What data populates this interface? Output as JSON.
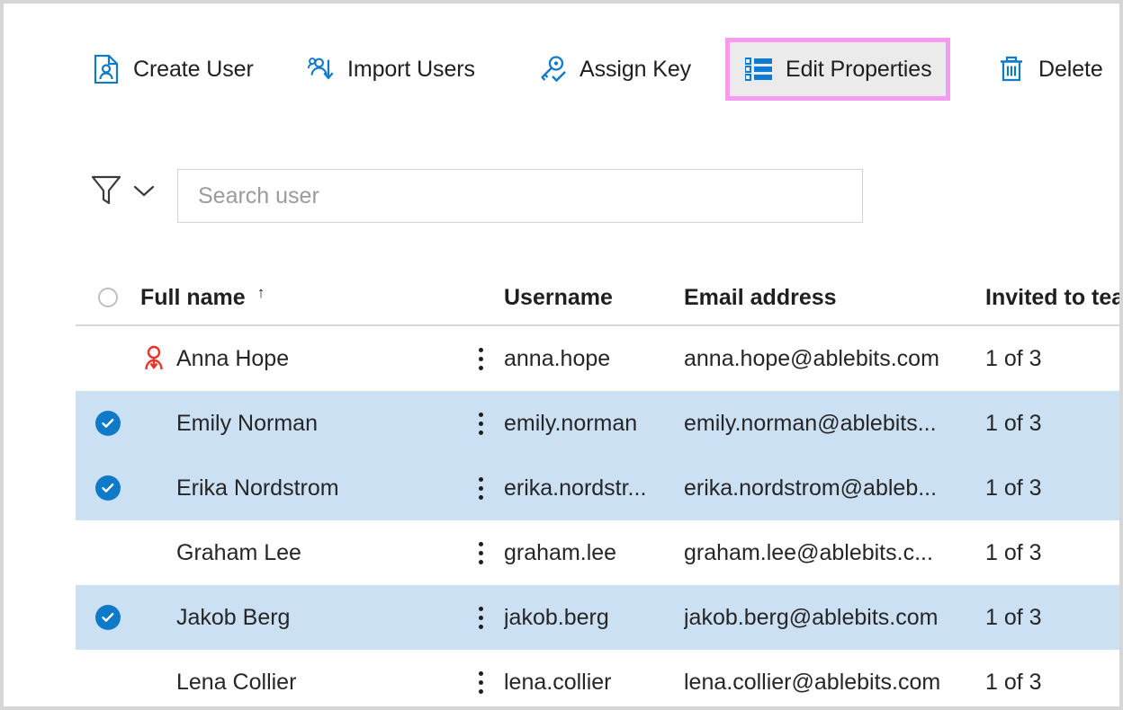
{
  "toolbar": {
    "items": [
      {
        "id": "create-user",
        "label": "Create User",
        "icon": "create-user-icon",
        "highlighted": false
      },
      {
        "id": "import-users",
        "label": "Import Users",
        "icon": "import-users-icon",
        "highlighted": false
      },
      {
        "id": "assign-key",
        "label": "Assign Key",
        "icon": "assign-key-icon",
        "highlighted": false
      },
      {
        "id": "edit-properties",
        "label": "Edit Properties",
        "icon": "edit-properties-icon",
        "highlighted": true
      },
      {
        "id": "delete",
        "label": "Delete",
        "icon": "trash-icon",
        "highlighted": false
      }
    ],
    "highlight_color": "#f79bf0",
    "highlight_fill": "#ebebeb",
    "icon_color": "#0f7ac8"
  },
  "filter": {
    "icon": "filter-funnel-icon",
    "chevron": "chevron-down-icon"
  },
  "search": {
    "value": "",
    "placeholder": "Search user"
  },
  "table": {
    "columns": [
      {
        "key": "full_name",
        "label": "Full name",
        "sorted": true,
        "sort_direction": "asc",
        "sort_glyph": "↑"
      },
      {
        "key": "username",
        "label": "Username"
      },
      {
        "key": "email",
        "label": "Email address"
      },
      {
        "key": "teams",
        "label": "Invited to teams"
      }
    ],
    "select_all": {
      "state": "unchecked",
      "icon": "radio-circle-icon"
    },
    "row_menu_icon": "more-vertical-icon",
    "selected_row_color": "#cce0f4",
    "check_icon_color": "#0f7ac8",
    "rows": [
      {
        "full_name": "Anna Hope",
        "username": "anna.hope",
        "email": "anna.hope@ablebits.com",
        "teams": "1 of 3",
        "selected": false,
        "status_icon": "user-pending-icon",
        "status_icon_color": "#e8342a"
      },
      {
        "full_name": "Emily Norman",
        "username": "emily.norman",
        "email": "emily.norman@ablebits...",
        "teams": "1 of 3",
        "selected": true,
        "status_icon": null,
        "status_icon_color": null
      },
      {
        "full_name": "Erika Nordstrom",
        "username": "erika.nordstr...",
        "email": "erika.nordstrom@ableb...",
        "teams": "1 of 3",
        "selected": true,
        "status_icon": null,
        "status_icon_color": null
      },
      {
        "full_name": "Graham Lee",
        "username": "graham.lee",
        "email": "graham.lee@ablebits.c...",
        "teams": "1 of 3",
        "selected": false,
        "status_icon": null,
        "status_icon_color": null
      },
      {
        "full_name": "Jakob Berg",
        "username": "jakob.berg",
        "email": "jakob.berg@ablebits.com",
        "teams": "1 of 3",
        "selected": true,
        "status_icon": null,
        "status_icon_color": null
      },
      {
        "full_name": "Lena Collier",
        "username": "lena.collier",
        "email": "lena.collier@ablebits.com",
        "teams": "1 of 3",
        "selected": false,
        "status_icon": null,
        "status_icon_color": null
      }
    ]
  }
}
